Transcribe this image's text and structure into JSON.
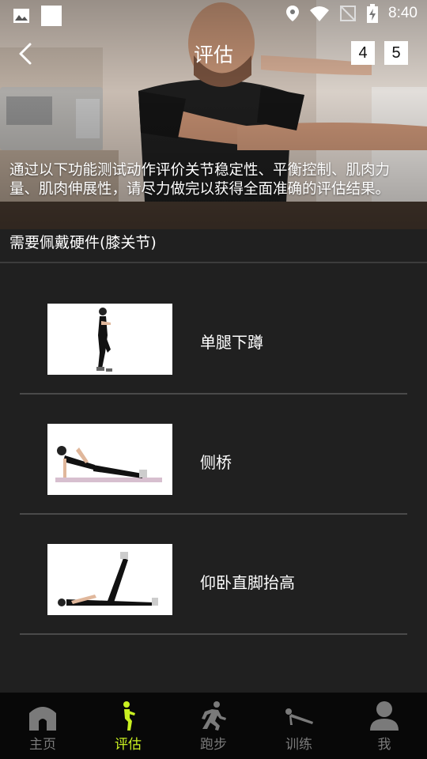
{
  "status_bar": {
    "time": "8:40",
    "icons": [
      "image-icon",
      "square-icon",
      "location-icon",
      "wifi-icon",
      "no-signal-icon",
      "battery-charging-icon"
    ]
  },
  "header": {
    "title": "评估",
    "back_icon": "chevron-left-icon",
    "pages": [
      "4",
      "5"
    ]
  },
  "intro_text": "通过以下功能测试动作评价关节稳定性、平衡控制、肌肉力量、肌肉伸展性，请尽力做完以获得全面准确的评估结果。",
  "hardware_note": "需要佩戴硬件(膝关节)",
  "exercises": [
    {
      "label": "单腿下蹲",
      "image": "single-leg-squat-thumbnail"
    },
    {
      "label": "侧桥",
      "image": "side-plank-thumbnail"
    },
    {
      "label": "仰卧直脚抬高",
      "image": "supine-straight-leg-raise-thumbnail"
    }
  ],
  "tabs": [
    {
      "label": "主页",
      "icon": "home-icon",
      "active": false
    },
    {
      "label": "评估",
      "icon": "assessment-figure-icon",
      "active": true
    },
    {
      "label": "跑步",
      "icon": "running-icon",
      "active": false
    },
    {
      "label": "训练",
      "icon": "pushup-icon",
      "active": false
    },
    {
      "label": "我",
      "icon": "person-icon",
      "active": false
    }
  ],
  "colors": {
    "background": "#202020",
    "tabbar": "#080808",
    "active_tab": "#c9f021",
    "inactive_tab": "#7a7a7a",
    "divider": "#4a4a4a"
  }
}
